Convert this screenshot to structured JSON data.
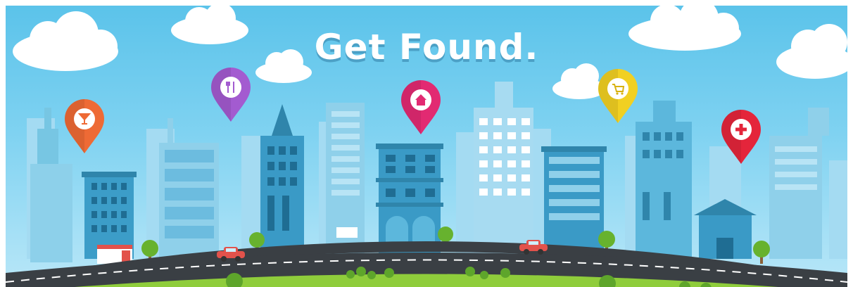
{
  "headline": "Get Found.",
  "pins": [
    {
      "icon": "cocktail-icon",
      "color": "#ee6a35"
    },
    {
      "icon": "fork-knife-icon",
      "color": "#a35bd0"
    },
    {
      "icon": "home-icon",
      "color": "#e22a72"
    },
    {
      "icon": "shopping-cart-icon",
      "color": "#f1d022"
    },
    {
      "icon": "medical-cross-icon",
      "color": "#e4253b"
    }
  ],
  "colors": {
    "sky": "#6ccbf0",
    "road": "#3a3f44",
    "grass": "#8fcd3b",
    "car": "#e2524b"
  }
}
